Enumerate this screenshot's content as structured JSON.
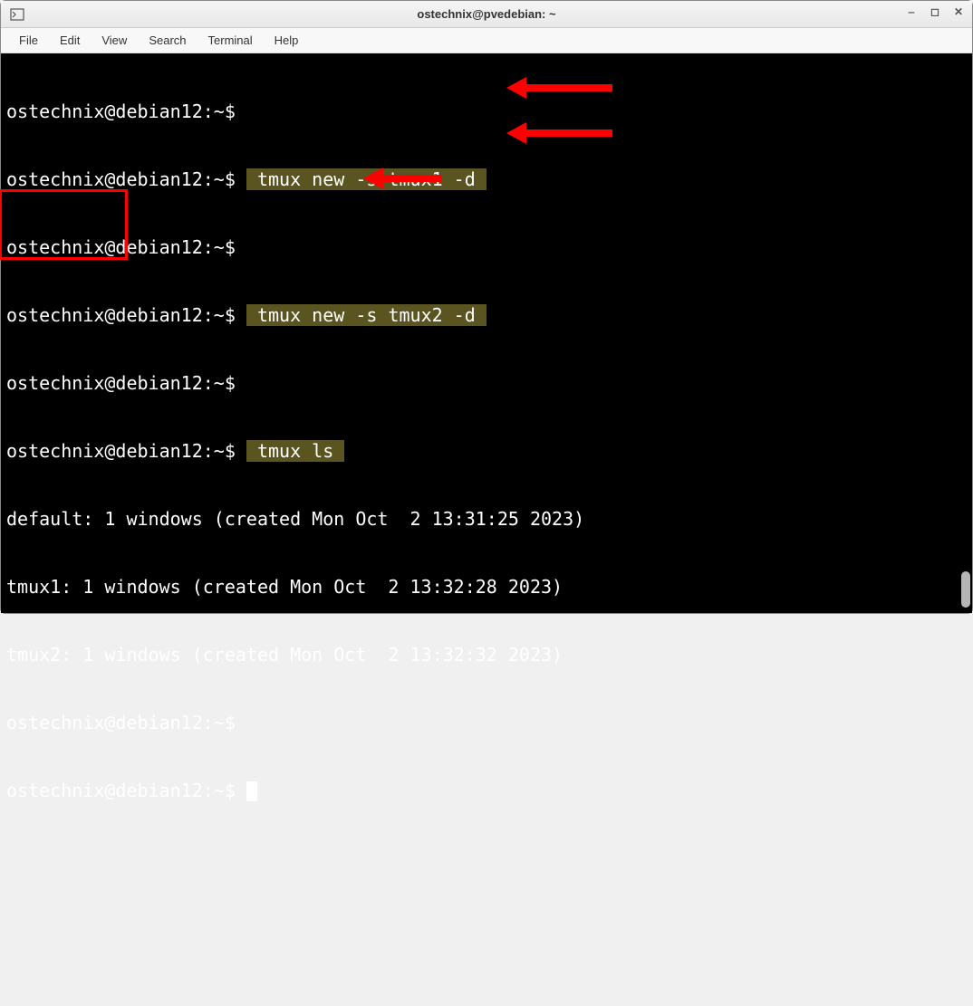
{
  "window": {
    "title": "ostechnix@pvedebian: ~"
  },
  "menubar": {
    "items": [
      "File",
      "Edit",
      "View",
      "Search",
      "Terminal",
      "Help"
    ]
  },
  "terminal": {
    "prompt": "ostechnix@debian12:~$ ",
    "lines": {
      "l0": "ostechnix@debian12:~$ ",
      "l1_pre": "ostechnix@debian12:~$ ",
      "l1_hl": " tmux new -s tmux1 -d ",
      "l2": "ostechnix@debian12:~$ ",
      "l3_pre": "ostechnix@debian12:~$ ",
      "l3_hl": " tmux new -s tmux2 -d ",
      "l4": "ostechnix@debian12:~$ ",
      "l5_pre": "ostechnix@debian12:~$ ",
      "l5_hl": " tmux ls ",
      "l6": "default: 1 windows (created Mon Oct  2 13:31:25 2023)",
      "l7": "tmux1: 1 windows (created Mon Oct  2 13:32:28 2023)",
      "l8": "tmux2: 1 windows (created Mon Oct  2 13:32:32 2023)",
      "l9": "ostechnix@debian12:~$ ",
      "l10": "ostechnix@debian12:~$ "
    }
  }
}
